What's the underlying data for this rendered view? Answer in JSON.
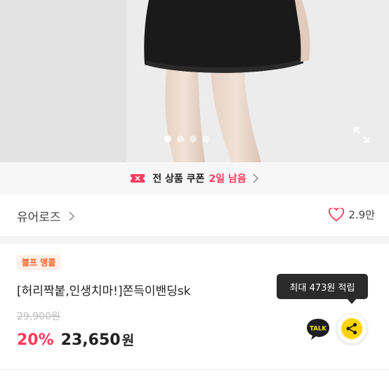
{
  "hero": {
    "carousel_total": 4,
    "carousel_active": 1
  },
  "coupon": {
    "label": "전 상품 쿠폰",
    "days_left": "2일 남음",
    "accent": "#ff3b5c"
  },
  "seller": {
    "name": "유어로즈",
    "likes": "2.9만"
  },
  "product": {
    "badge": "블프 앵콜",
    "title": "[허리짝붙,인생치마!]쫀득이밴딩sk",
    "original_price": "29,900원",
    "discount": "20%",
    "price": "23,650",
    "currency": "원"
  },
  "reward_tooltip": "최대 473원 적립",
  "icons": {
    "talk": "kakao-talk-icon",
    "share": "share-icon",
    "heart": "heart-outline-icon",
    "expand": "expand-icon"
  },
  "next_row": {
    "left": "",
    "discount": "",
    "price": ""
  }
}
